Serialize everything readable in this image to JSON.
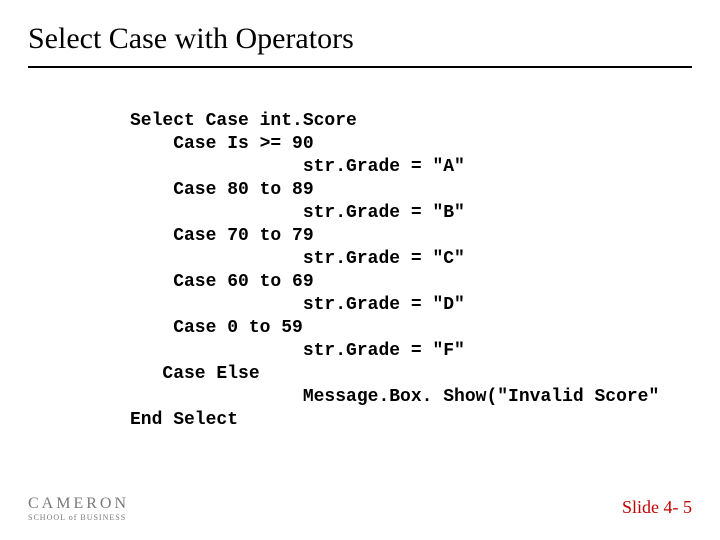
{
  "title": "Select Case with Operators",
  "code": "Select Case int.Score\n    Case Is >= 90\n                str.Grade = \"A\"\n    Case 80 to 89\n                str.Grade = \"B\"\n    Case 70 to 79\n                str.Grade = \"C\"\n    Case 60 to 69\n                str.Grade = \"D\"\n    Case 0 to 59\n                str.Grade = \"F\"\n   Case Else\n                Message.Box. Show(\"Invalid Score\"\nEnd Select",
  "logo": {
    "line1": "CAMERON",
    "line2": "SCHOOL of BUSINESS"
  },
  "footer": "Slide 4- 5"
}
